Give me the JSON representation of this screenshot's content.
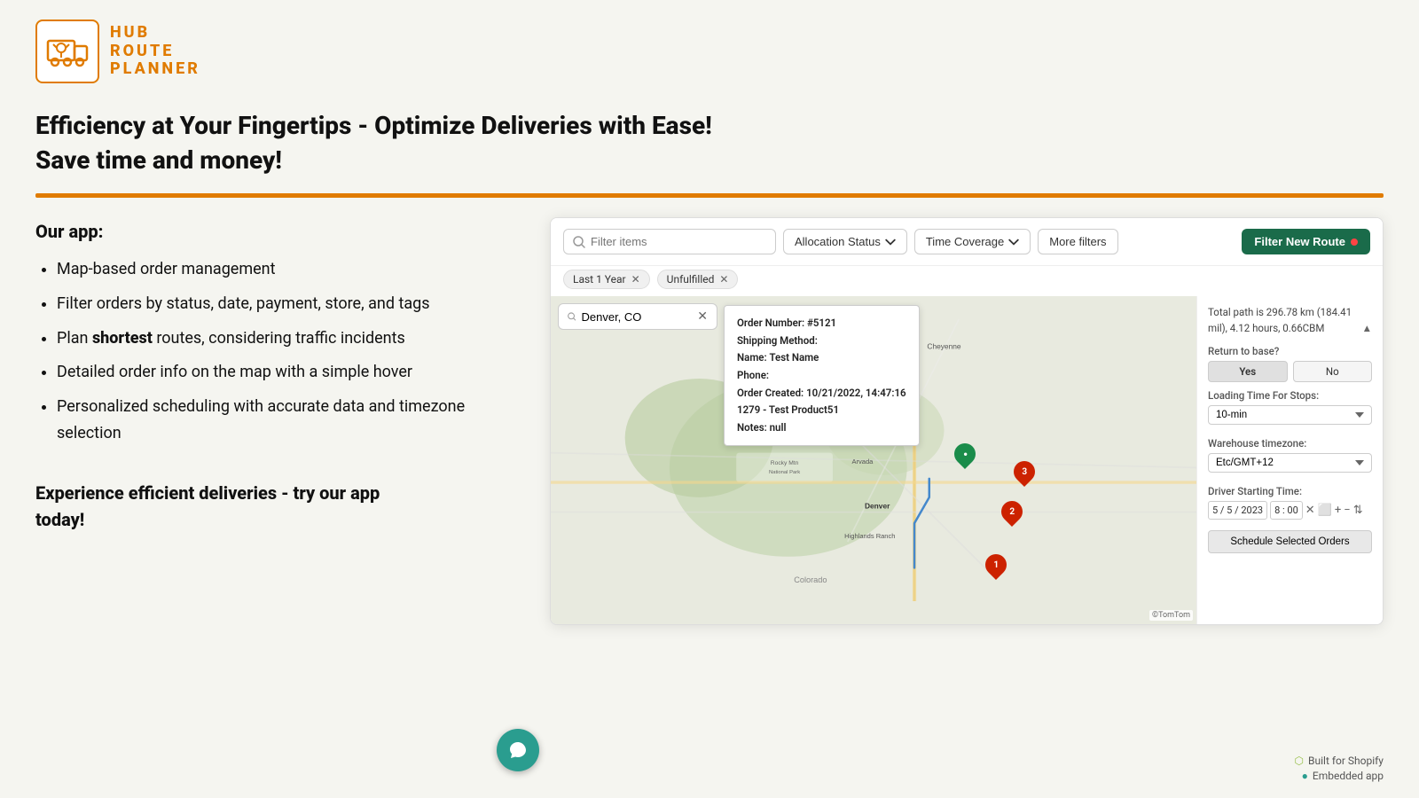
{
  "logo": {
    "lines": [
      "HUB",
      "ROUTE",
      "PLANNER"
    ]
  },
  "headline": {
    "line1": "Efficiency at Your Fingertips - Optimize Deliveries with Ease!",
    "line2": "Save time and money!"
  },
  "features": {
    "title": "Our app:",
    "items": [
      "Map-based order management",
      "Filter orders by status, date, payment, store, and tags",
      "Plan shortest routes, considering traffic incidents",
      "Detailed order info on the map with a simple hover",
      "Personalized scheduling with accurate data and timezone selection"
    ],
    "shortBolds": [
      "shortest"
    ]
  },
  "cta": {
    "line1": "Experience efficient deliveries - try our app",
    "line2": "today!"
  },
  "app": {
    "search": {
      "placeholder": "Filter items"
    },
    "filters": {
      "allocation_status": "Allocation Status",
      "time_coverage": "Time Coverage",
      "more_filters": "More filters",
      "filter_new_route": "Filter New Route"
    },
    "tags": [
      {
        "label": "Last 1 Year",
        "removable": true
      },
      {
        "label": "Unfulfilled",
        "removable": true
      }
    ],
    "map_search": {
      "value": "Denver, CO"
    },
    "order_popup": {
      "order_number_label": "Order Number:",
      "order_number": "#5121",
      "shipping_label": "Shipping Method:",
      "shipping_value": "",
      "name_label": "Name:",
      "name_value": "Test Name",
      "phone_label": "Phone:",
      "phone_value": "",
      "order_created_label": "Order Created:",
      "order_created_value": "10/21/2022, 14:47:16",
      "product_label": "1279 - Test Product51",
      "notes_label": "Notes:",
      "notes_value": "null"
    },
    "sidebar": {
      "path_info": "Total path is 296.78 km (184.41 mil), 4.12 hours, 0.66CBM",
      "return_base_label": "Return to base?",
      "yes_label": "Yes",
      "no_label": "No",
      "loading_time_label": "Loading Time For Stops:",
      "loading_time_value": "10-min",
      "warehouse_timezone_label": "Warehouse timezone:",
      "warehouse_timezone_value": "Etc/GMT+12",
      "driver_starting_label": "Driver Starting Time:",
      "driver_date": "5 / 5 / 2023",
      "driver_time": "8 : 00",
      "schedule_btn": "Schedule Selected Orders"
    }
  },
  "footer": {
    "built_label": "Built for Shopify",
    "embedded_label": "Embedded app"
  },
  "tomtom": "©TomTom"
}
